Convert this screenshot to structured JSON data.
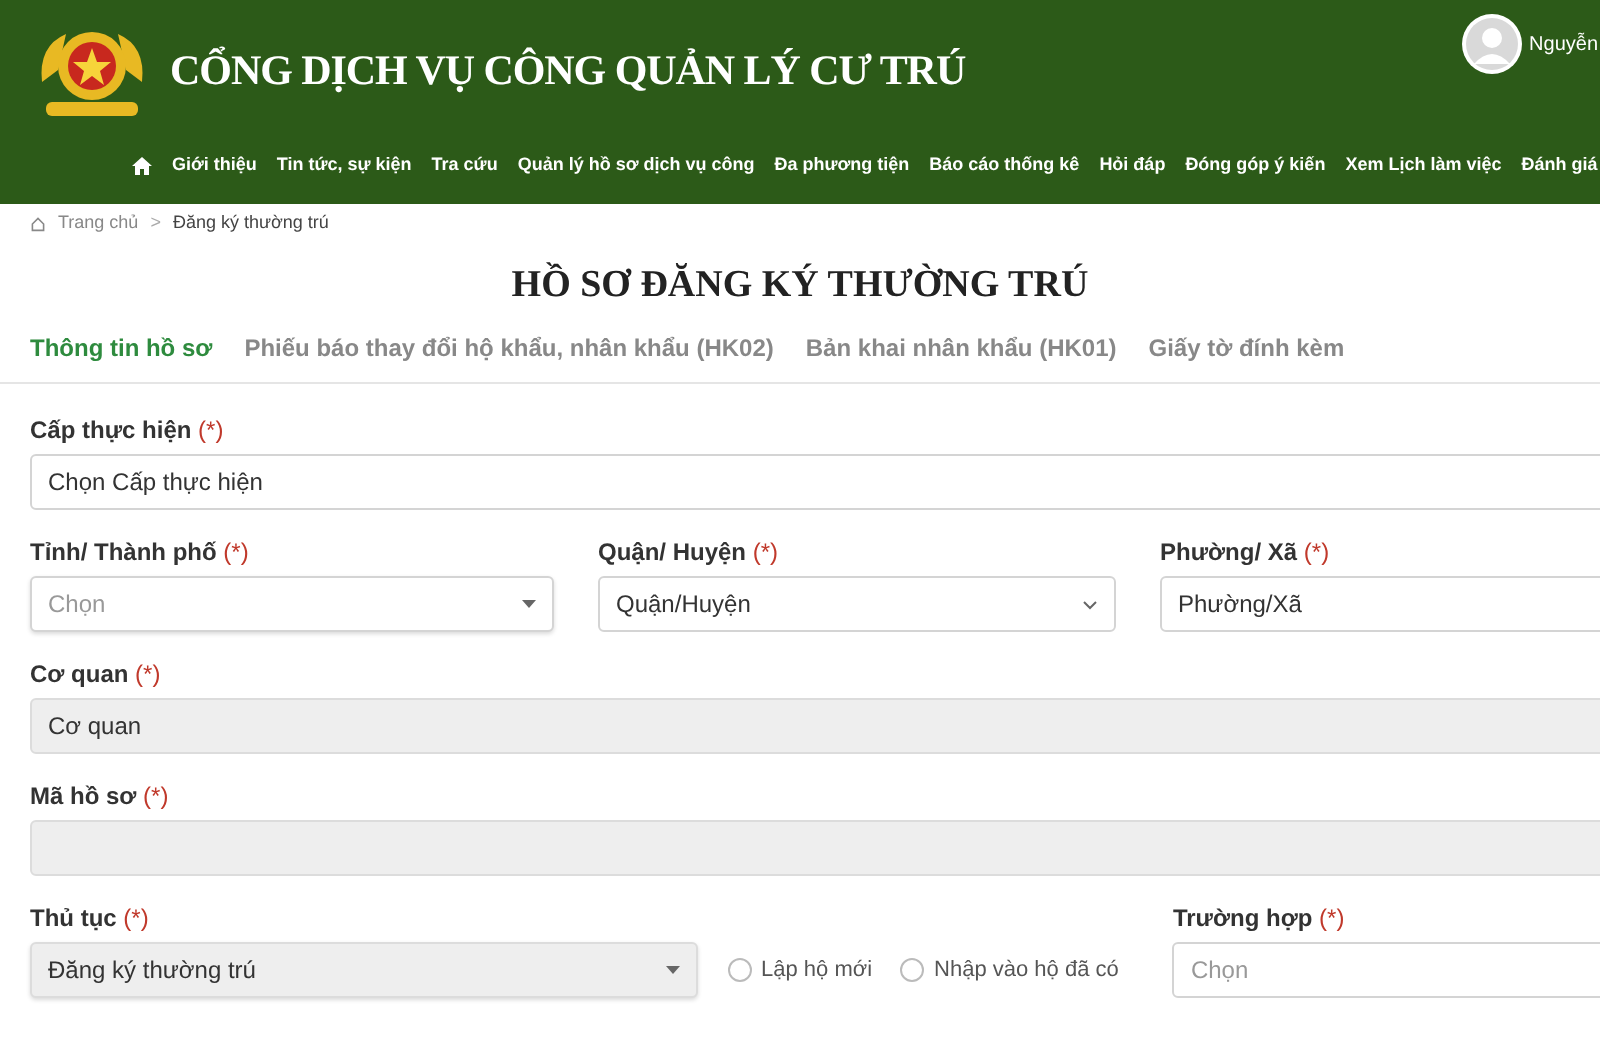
{
  "header": {
    "title": "CỔNG DỊCH VỤ CÔNG QUẢN LÝ CƯ TRÚ",
    "user": "Nguyễn"
  },
  "nav": [
    "Giới thiệu",
    "Tin tức, sự kiện",
    "Tra cứu",
    "Quản lý hồ sơ dịch vụ công",
    "Đa phương tiện",
    "Báo cáo thống kê",
    "Hỏi đáp",
    "Đóng góp ý kiến",
    "Xem Lịch làm việc",
    "Đánh giá"
  ],
  "breadcrumb": [
    "Trang chủ",
    ">",
    "Đăng ký thường trú"
  ],
  "page_title": "HỒ SƠ ĐĂNG KÝ THƯỜNG TRÚ",
  "tabs": [
    {
      "label": "Thông tin hồ sơ",
      "selected": true
    },
    {
      "label": "Phiếu báo thay đổi hộ khẩu, nhân khẩu (HK02)",
      "selected": false
    },
    {
      "label": "Bản khai nhân khẩu (HK01)",
      "selected": false
    },
    {
      "label": "Giấy tờ đính kèm",
      "selected": false
    }
  ],
  "required_mark": "(*)",
  "rows": [
    [
      {
        "label": "Cấp thực hiện",
        "kind": "text",
        "value": "Chọn Cấp thực hiện",
        "disabled": false
      }
    ],
    [
      {
        "label": "Tỉnh/ Thành phố",
        "kind": "select",
        "placeholder": "Chọn",
        "disabled": false
      },
      {
        "label": "Quận/ Huyện",
        "kind": "dropdown",
        "value": "Quận/Huyện",
        "disabled": false
      },
      {
        "label": "Phường/ Xã",
        "kind": "text",
        "value": "Phường/Xã",
        "disabled": false
      }
    ],
    [
      {
        "label": "Cơ quan",
        "kind": "text",
        "value": "Cơ quan",
        "disabled": true
      }
    ],
    [
      {
        "label": "Mã hồ sơ",
        "kind": "text",
        "disabled": true
      }
    ]
  ],
  "procedure": {
    "label": "Thủ tục",
    "value": "Đăng ký thường trú",
    "disabled": true,
    "options": [
      {
        "label": "Lập hộ mới",
        "checked": false
      },
      {
        "label": "Nhập vào hộ đã có",
        "checked": false
      }
    ]
  },
  "case_field": {
    "label": "Trường hợp",
    "placeholder": "Chọn",
    "disabled": false
  }
}
